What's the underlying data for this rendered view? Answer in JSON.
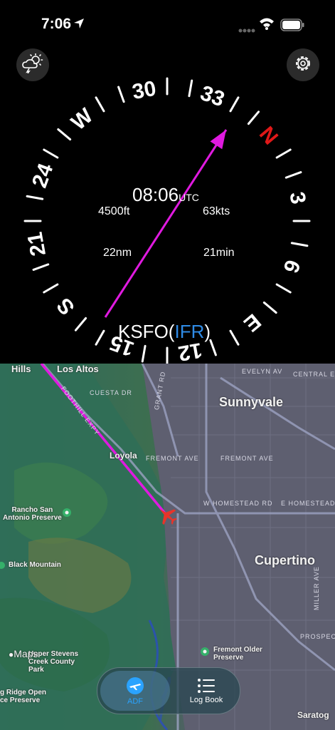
{
  "status_bar": {
    "time": "7:06"
  },
  "compass": {
    "cardinals": [
      "N",
      "3",
      "6",
      "E",
      "12",
      "15",
      "S",
      "21",
      "24",
      "W",
      "30",
      "33"
    ],
    "north_color": "#e01818",
    "utc_time": "08:06",
    "utc_label": "UTC",
    "altitude": "4500ft",
    "speed": "63kts",
    "distance": "22nm",
    "eta": "21min",
    "destination": "KSFO",
    "flight_rule": "IFR",
    "bearing_deg": 310,
    "needle_color": "#e01ae0"
  },
  "map": {
    "labels": {
      "hills": "Hills",
      "los_altos": "Los Altos",
      "sunnyvale": "Sunnyvale",
      "loyola": "Loyola",
      "cupertino": "Cupertino",
      "rancho": "Rancho San\nAntonio Preserve",
      "black_mountain": "Black Mountain",
      "fremont_older": "Fremont Older\nPreserve",
      "stevens": "Upper Stevens\nCreek County\nPark",
      "ridge": "g Ridge Open\nce Preserve",
      "saratoga": "Saratog",
      "maps_logo": "Maps"
    },
    "roads": {
      "evelyn": "EVELYN AV",
      "central": "CENTRAL EX",
      "cuesta": "CUESTA DR",
      "grant": "GRANT RD",
      "foothill": "FOOTHILL EXPY",
      "fremont1": "FREMONT AVE",
      "fremont2": "FREMONT AVE",
      "homestead": "W HOMESTEAD RD",
      "e_homestead": "E HOMESTEAD R",
      "miller": "MILLER AVE",
      "prospect": "PROSPECT"
    }
  },
  "tabs": [
    {
      "label": "ADF",
      "active": true
    },
    {
      "label": "Log Book",
      "active": false
    }
  ]
}
